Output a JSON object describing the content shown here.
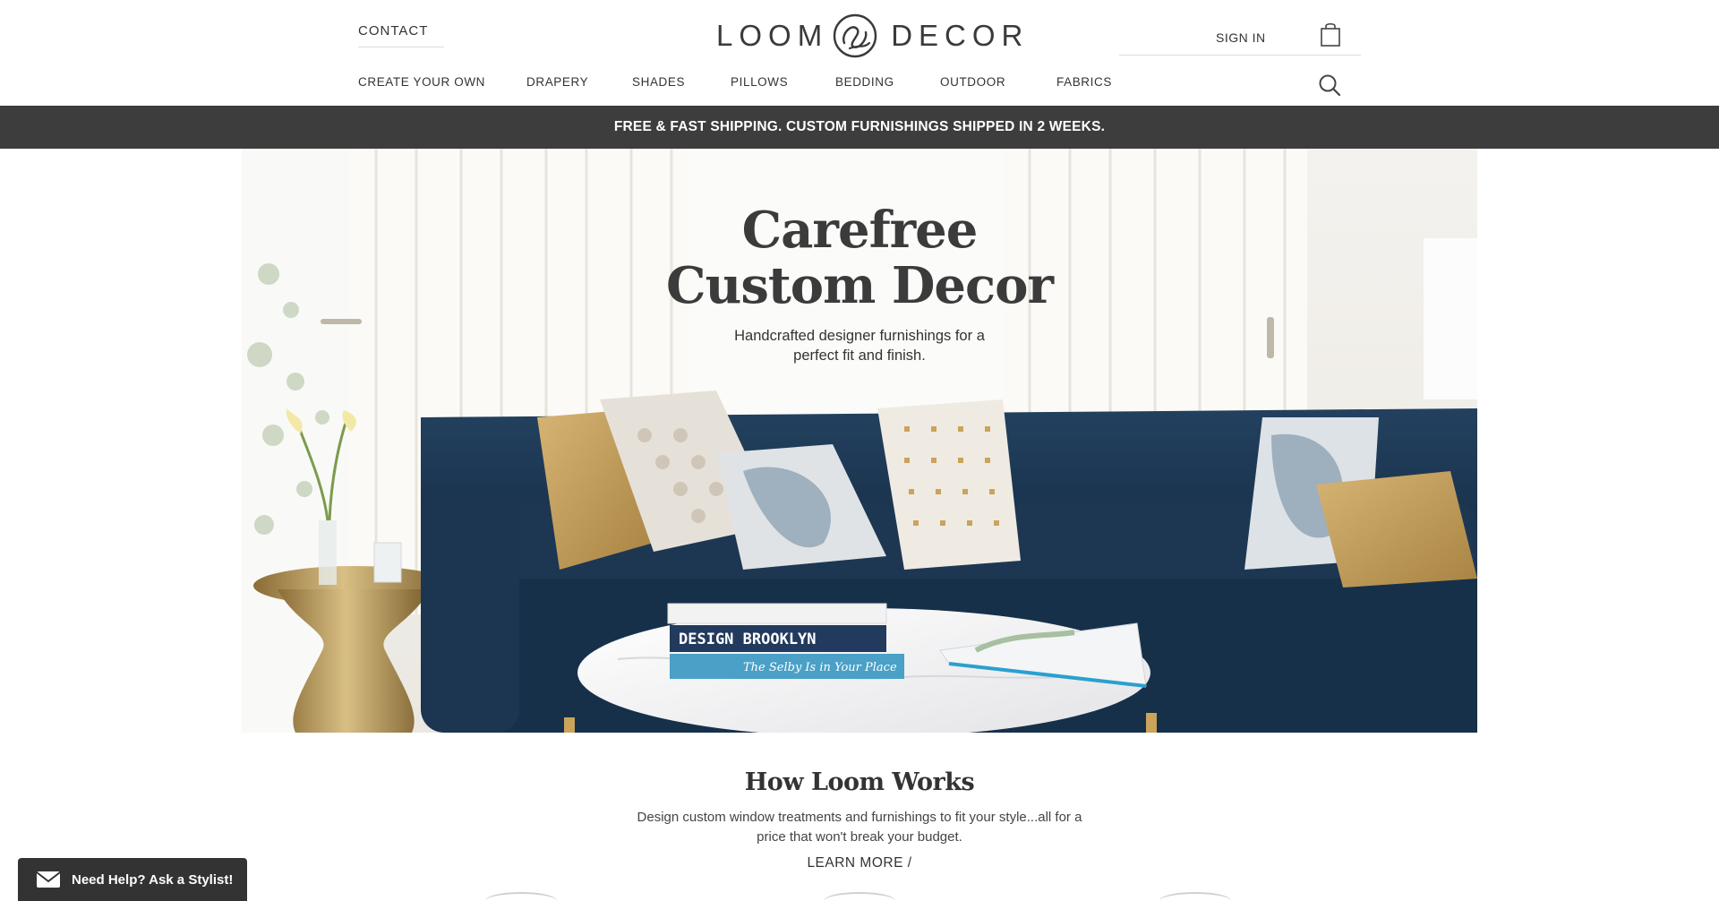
{
  "header": {
    "contact_label": "CONTACT",
    "logo_left": "LOOM",
    "logo_right": "DECOR",
    "signin_label": "SIGN IN"
  },
  "nav": {
    "items": [
      {
        "label": "CREATE YOUR OWN"
      },
      {
        "label": "DRAPERY"
      },
      {
        "label": "SHADES"
      },
      {
        "label": "PILLOWS"
      },
      {
        "label": "BEDDING"
      },
      {
        "label": "OUTDOOR"
      },
      {
        "label": "FABRICS"
      }
    ]
  },
  "promo": {
    "text": "FREE & FAST SHIPPING. CUSTOM FURNISHINGS SHIPPED IN 2 WEEKS."
  },
  "hero": {
    "title_line1": "Carefree",
    "title_line2": "Custom Decor",
    "subtitle_line1": "Handcrafted designer furnishings for a",
    "subtitle_line2": "perfect fit and finish.",
    "book1_title": "DESIGN BROOKLYN",
    "book2_title": "The Selby Is in Your Place"
  },
  "how": {
    "title": "How Loom Works",
    "desc_line1": "Design custom window treatments and furnishings to fit your style...all for a",
    "desc_line2": "price that won't break your budget.",
    "learn_more": "LEARN MORE /"
  },
  "chat": {
    "label": "Need Help? Ask a Stylist!"
  },
  "icons": [
    "logo-mark-icon",
    "shopping-bag-icon",
    "search-icon",
    "envelope-icon"
  ],
  "colors": {
    "promo_bg": "#3d3d3d",
    "sofa": "#1f3b58",
    "accent_gold": "#c9a45a"
  }
}
